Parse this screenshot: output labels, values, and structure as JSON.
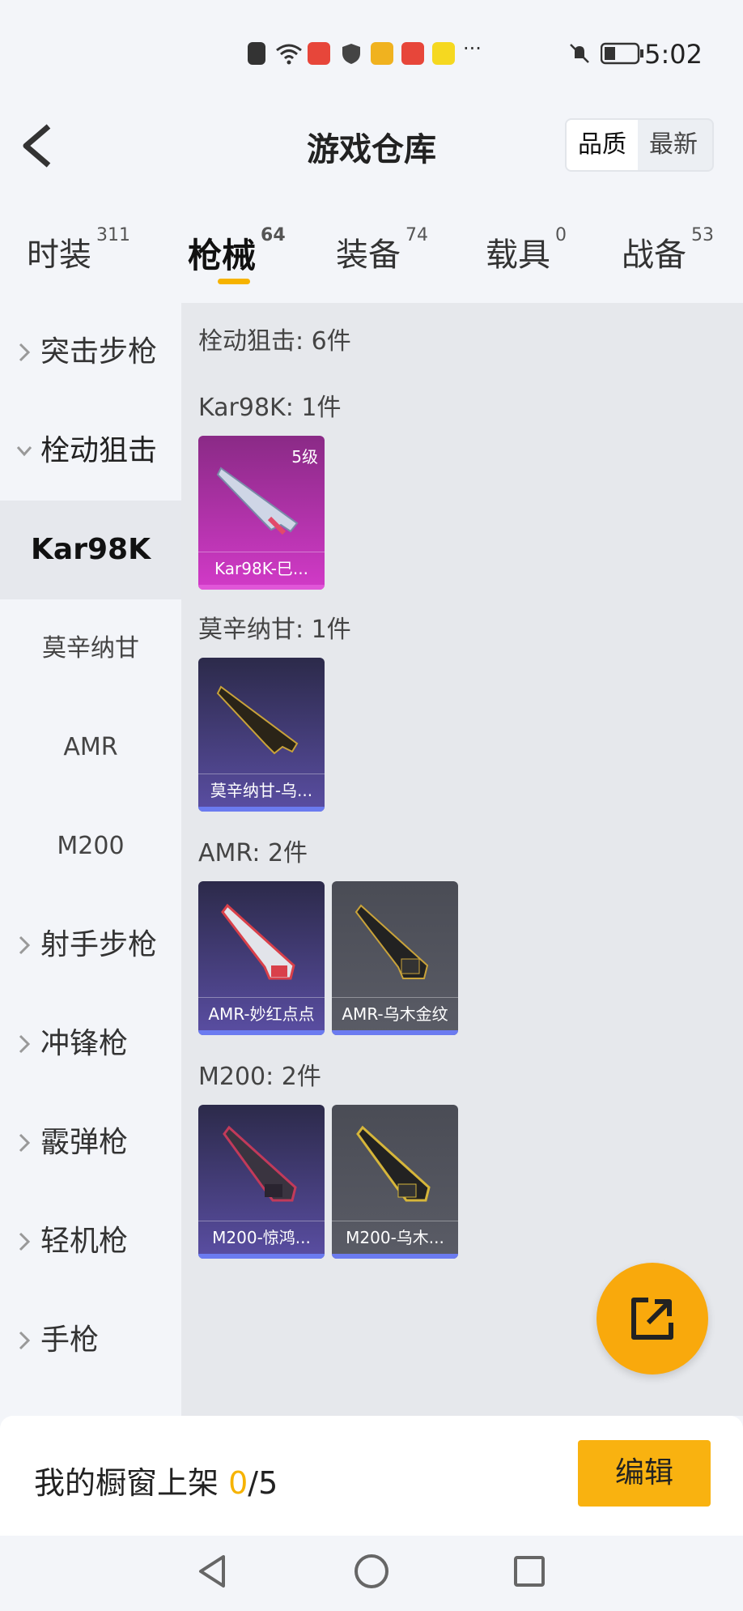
{
  "status_bar": {
    "time": "5:02"
  },
  "header": {
    "title": "游戏仓库",
    "sort_options": [
      "品质",
      "最新"
    ]
  },
  "tabs": [
    {
      "label": "时装",
      "count": "311"
    },
    {
      "label": "枪械",
      "count": "64"
    },
    {
      "label": "装备",
      "count": "74"
    },
    {
      "label": "载具",
      "count": "0"
    },
    {
      "label": "战备",
      "count": "53"
    }
  ],
  "sidebar": {
    "categories": [
      "突击步枪",
      "栓动狙击",
      "射手步枪",
      "冲锋枪",
      "霰弹枪",
      "轻机枪",
      "手枪"
    ],
    "subitems": [
      "Kar98K",
      "莫辛纳甘",
      "AMR",
      "M200"
    ]
  },
  "main": {
    "section_title": "栓动狙击: 6件",
    "groups": [
      {
        "label": "Kar98K: 1件",
        "items": [
          {
            "name": "Kar98K-巳...",
            "level": "5级"
          }
        ]
      },
      {
        "label": "莫辛纳甘: 1件",
        "items": [
          {
            "name": "莫辛纳甘-乌..."
          }
        ]
      },
      {
        "label": "AMR: 2件",
        "items": [
          {
            "name": "AMR-妙红点点"
          },
          {
            "name": "AMR-乌木金纹"
          }
        ]
      },
      {
        "label": "M200: 2件",
        "items": [
          {
            "name": "M200-惊鸿..."
          },
          {
            "name": "M200-乌木..."
          }
        ]
      }
    ]
  },
  "bottom": {
    "label_prefix": "我的橱窗上架 ",
    "count_current": "0",
    "count_total": "/5",
    "edit_label": "编辑"
  },
  "colors": {
    "accent": "#f6b300",
    "pink_card": "#c93ac0",
    "purple_card": "#4b4390",
    "grey_card": "#55575f",
    "bar_blue": "#6b7bf0"
  }
}
